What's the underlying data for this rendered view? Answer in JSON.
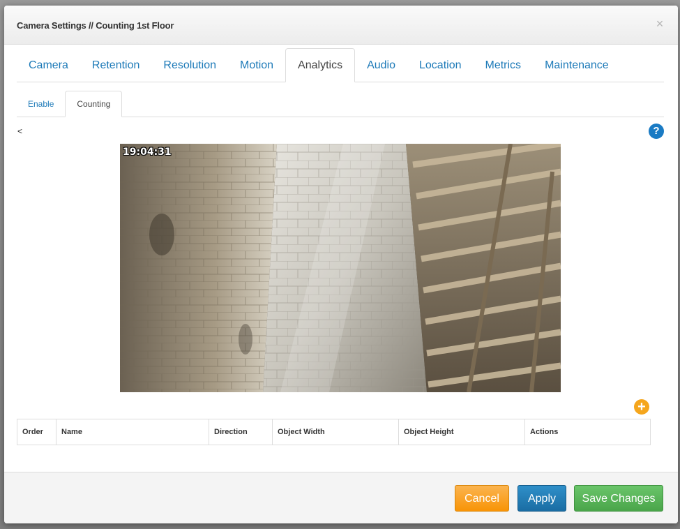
{
  "dialog": {
    "title": "Camera Settings // Counting 1st Floor",
    "close_glyph": "×"
  },
  "main_tabs": [
    {
      "label": "Camera",
      "active": false
    },
    {
      "label": "Retention",
      "active": false
    },
    {
      "label": "Resolution",
      "active": false
    },
    {
      "label": "Motion",
      "active": false
    },
    {
      "label": "Analytics",
      "active": true
    },
    {
      "label": "Audio",
      "active": false
    },
    {
      "label": "Location",
      "active": false
    },
    {
      "label": "Metrics",
      "active": false
    },
    {
      "label": "Maintenance",
      "active": false
    }
  ],
  "sub_tabs": [
    {
      "label": "Enable",
      "active": false
    },
    {
      "label": "Counting",
      "active": true
    }
  ],
  "back_link": "<",
  "help_icon": {
    "glyph": "?",
    "icon": "question-circle-icon",
    "color": "#1a7bc4"
  },
  "camera": {
    "timestamp": "19:04:31"
  },
  "add_icon": {
    "glyph": "+",
    "icon": "plus-circle-icon",
    "color": "#f5a61d"
  },
  "table": {
    "columns": [
      "Order",
      "Name",
      "Direction",
      "Object Width",
      "Object Height",
      "Actions"
    ],
    "rows": []
  },
  "footer": {
    "cancel_label": "Cancel",
    "apply_label": "Apply",
    "save_label": "Save Changes"
  },
  "colors": {
    "link": "#1d7ab8",
    "cancel": "#f89406",
    "apply": "#1a6da3",
    "save": "#4aa54a"
  }
}
